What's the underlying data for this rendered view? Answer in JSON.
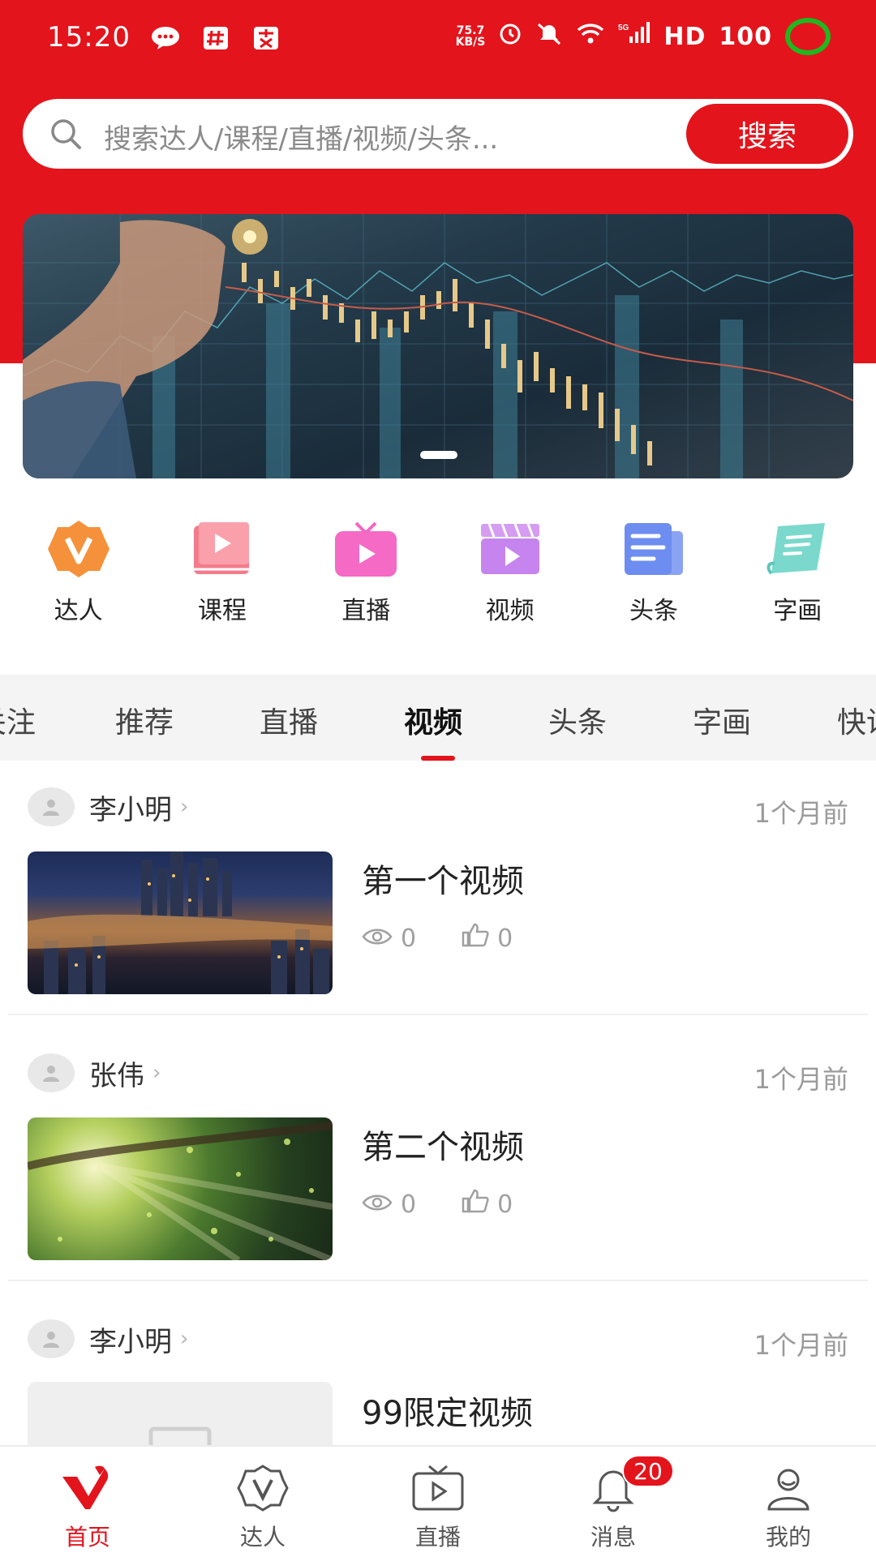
{
  "status_bar": {
    "time": "15:20",
    "net_speed_value": "75.7",
    "net_speed_unit": "KB/S",
    "hd_label": "HD",
    "battery": "100",
    "signal_label": "5G"
  },
  "search": {
    "placeholder": "搜索达人/课程/直播/视频/头条...",
    "button_label": "搜索"
  },
  "banner": {
    "page_count": 1,
    "current_page": 1
  },
  "categories": [
    {
      "label": "达人",
      "icon": "talent-badge-icon"
    },
    {
      "label": "课程",
      "icon": "course-book-icon"
    },
    {
      "label": "直播",
      "icon": "live-tv-icon"
    },
    {
      "label": "视频",
      "icon": "video-clapper-icon"
    },
    {
      "label": "头条",
      "icon": "news-icon"
    },
    {
      "label": "字画",
      "icon": "calligraphy-scroll-icon"
    }
  ],
  "tabs": [
    {
      "label": "关注"
    },
    {
      "label": "推荐"
    },
    {
      "label": "直播"
    },
    {
      "label": "视频",
      "active": true
    },
    {
      "label": "头条"
    },
    {
      "label": "字画"
    },
    {
      "label": "快讯"
    }
  ],
  "feed": [
    {
      "author": "李小明",
      "time": "1个月前",
      "title": "第一个视频",
      "views": "0",
      "likes": "0"
    },
    {
      "author": "张伟",
      "time": "1个月前",
      "title": "第二个视频",
      "views": "0",
      "likes": "0"
    },
    {
      "author": "李小明",
      "time": "1个月前",
      "title": "99限定视频"
    }
  ],
  "bottom_nav": [
    {
      "label": "首页",
      "active": true
    },
    {
      "label": "达人"
    },
    {
      "label": "直播"
    },
    {
      "label": "消息",
      "badge": "20"
    },
    {
      "label": "我的"
    }
  ],
  "colors": {
    "brand_red": "#e3141c",
    "status_ring_green": "#1fb81f"
  }
}
